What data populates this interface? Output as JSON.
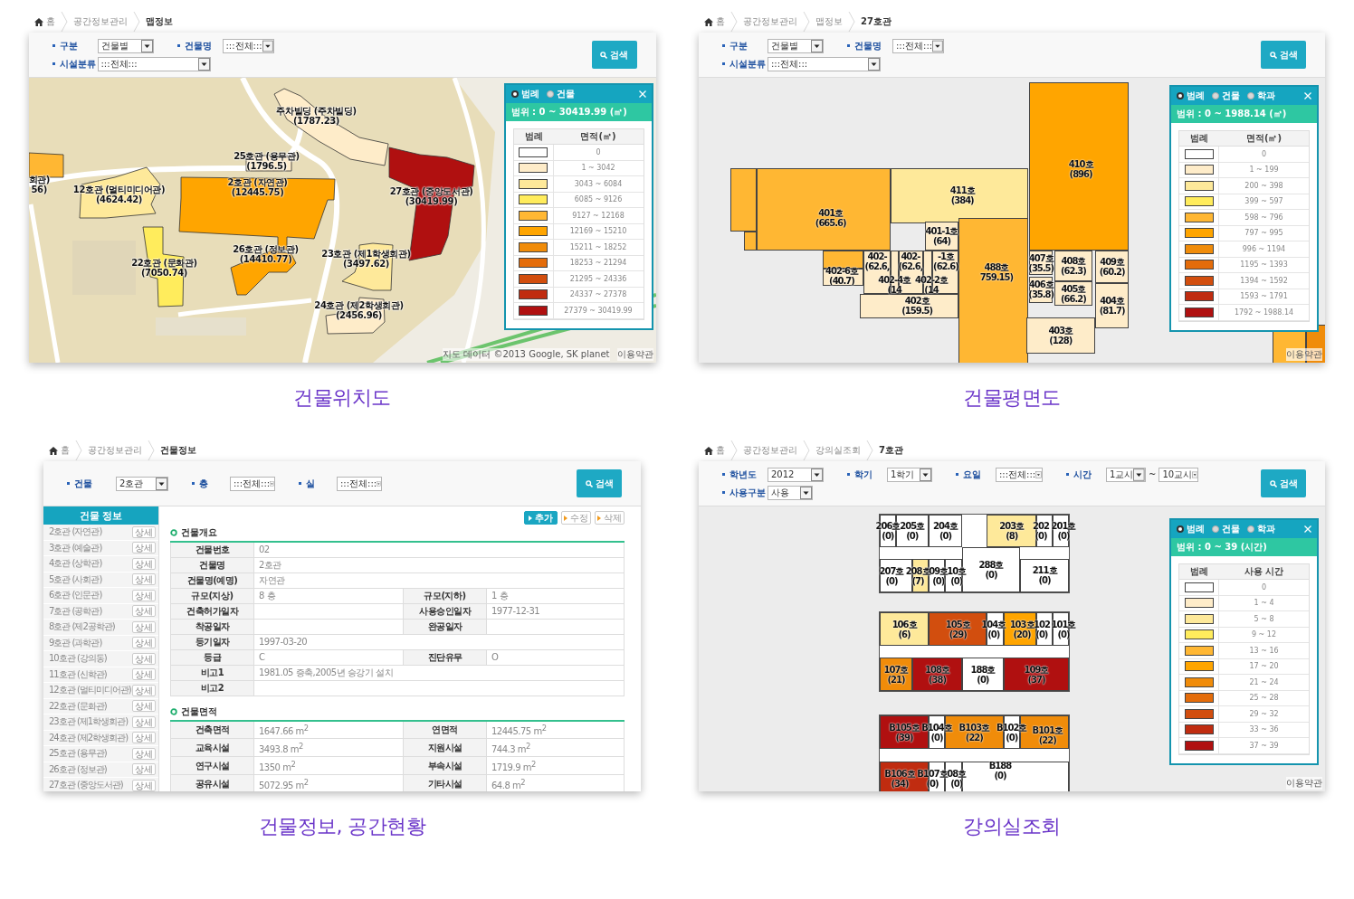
{
  "panels": [
    {
      "kind": "map",
      "breadcrumb": [
        "홈",
        "공간정보관리",
        "맵정보"
      ],
      "filter_rows": [
        [
          {
            "label": "구분",
            "values": [
              "건물별"
            ]
          },
          {
            "label": "건물명",
            "values": [
              ":::전체:::"
            ]
          }
        ],
        [
          {
            "label": "시설분류",
            "values": [
              ":::전체:::"
            ]
          }
        ]
      ],
      "search": "검색",
      "buildings": [
        {
          "name": "주차빌딩 (주차빌딩)",
          "area": "(1787.23)",
          "color": "#feecc9"
        },
        {
          "name": "회관)",
          "area": "56)",
          "color": "#ffb733"
        },
        {
          "name": "25호관 (용무관)",
          "area": "(1796.5)",
          "color": "#feecc9"
        },
        {
          "name": "2호관 (자연관)",
          "area": "(12445.75)",
          "color": "#ffa500"
        },
        {
          "name": "12호관 (멀티미디어관)",
          "area": "(4624.42)",
          "color": "#fee99a"
        },
        {
          "name": "27호관 (중앙도서관)",
          "area": "(30419.99)",
          "color": "#b01010"
        },
        {
          "name": "26호관 (정보관)",
          "area": "(14410.77)",
          "color": "#ffa500"
        },
        {
          "name": "22호관 (문화관)",
          "area": "(7050.74)",
          "color": "#ffec5c"
        },
        {
          "name": "23호관 (제1학생회관)",
          "area": "(3497.62)",
          "color": "#fee99a"
        },
        {
          "name": "24호관 (제2학생회관)",
          "area": "(2456.96)",
          "color": "#feecc9"
        }
      ],
      "legend": {
        "options": [
          {
            "label": "범례",
            "selected": true
          },
          {
            "label": "건물",
            "selected": false
          }
        ],
        "range": "범위 : 0 ~ 30419.99 (㎡)",
        "columns": [
          "범례",
          "면적(㎡)"
        ],
        "rows": [
          {
            "color": "#ffffff",
            "range": "0"
          },
          {
            "color": "#feecc9",
            "range": "1 ~ 3042"
          },
          {
            "color": "#fee99a",
            "range": "3043 ~ 6084"
          },
          {
            "color": "#ffec5c",
            "range": "6085 ~ 9126"
          },
          {
            "color": "#ffb733",
            "range": "9127 ~ 12168"
          },
          {
            "color": "#ffa500",
            "range": "12169 ~ 15210"
          },
          {
            "color": "#f08c0a",
            "range": "15211 ~ 18252"
          },
          {
            "color": "#e46c0a",
            "range": "18253 ~ 21294"
          },
          {
            "color": "#d24e0e",
            "range": "21295 ~ 24336"
          },
          {
            "color": "#c02c10",
            "range": "24337 ~ 27378"
          },
          {
            "color": "#b01010",
            "range": "27379 ~ 30419.99"
          }
        ]
      },
      "attribution": "지도 데이터 ©2013 Google, SK planet",
      "terms": "이용약관",
      "caption": "건물위치도"
    },
    {
      "kind": "floorplan",
      "breadcrumb": [
        "홈",
        "공간정보관리",
        "맵정보",
        "27호관"
      ],
      "filter_rows": [
        [
          {
            "label": "구분",
            "values": [
              "건물별"
            ]
          },
          {
            "label": "건물명",
            "values": [
              ":::전체:::"
            ]
          }
        ],
        [
          {
            "label": "시설분류",
            "values": [
              ":::전체:::"
            ]
          }
        ]
      ],
      "search": "검색",
      "rooms": [
        {
          "color": "#ffb733"
        },
        {
          "name": "401호",
          "value": "(665.6)",
          "color": "#ffb733"
        },
        {
          "color": "#ffb733"
        },
        {
          "color": "#ffb733"
        },
        {
          "name": "411호",
          "value": "(384)",
          "color": "#fee99a"
        },
        {
          "name": "410호",
          "value": "(896)",
          "color": "#ffa500"
        },
        {
          "name": "401-1호",
          "value": "(64)",
          "color": "#feecc9"
        },
        {
          "name": "402-6호",
          "value": "(40.7)",
          "color": "#feecc9"
        },
        {
          "name": "402-",
          "value": "(62.6,",
          "color": "#feecc9"
        },
        {
          "name": "402-4호",
          "value": "(14",
          "color": "#feecc9"
        },
        {
          "name": "402-",
          "value": "(62.6,",
          "color": "#feecc9"
        },
        {
          "name": "402-2호",
          "value": "(14",
          "color": "#feecc9"
        },
        {
          "name": "-1호",
          "value": "(62.6)",
          "color": "#feecc9"
        },
        {
          "name": "402호",
          "value": "(159.5)",
          "color": "#feecc9"
        },
        {
          "name": "488호",
          "value": "759.15)",
          "color": "#ffb733"
        },
        {
          "name": "407호",
          "value": "(35.5)",
          "color": "#feecc9"
        },
        {
          "name": "408호",
          "value": "(62.3)",
          "color": "#feecc9"
        },
        {
          "name": "409호",
          "value": "(60.2)",
          "color": "#feecc9"
        },
        {
          "name": "406호",
          "value": "(35.8)",
          "color": "#feecc9"
        },
        {
          "name": "405호",
          "value": "(66.2)",
          "color": "#feecc9"
        },
        {
          "name": "404호",
          "value": "(81.7)",
          "color": "#feecc9"
        },
        {
          "name": "403호",
          "value": "(128)",
          "color": "#feecc9"
        },
        {
          "color": "#ffb733"
        },
        {
          "color": "#f08c0a"
        }
      ],
      "legend": {
        "options": [
          {
            "label": "범례",
            "selected": true
          },
          {
            "label": "건물",
            "selected": false
          },
          {
            "label": "학과",
            "selected": false
          }
        ],
        "range": "범위 : 0 ~ 1988.14 (㎡)",
        "columns": [
          "범례",
          "면적(㎡)"
        ],
        "rows": [
          {
            "color": "#ffffff",
            "range": "0"
          },
          {
            "color": "#feecc9",
            "range": "1 ~ 199"
          },
          {
            "color": "#fee99a",
            "range": "200 ~ 398"
          },
          {
            "color": "#ffec5c",
            "range": "399 ~ 597"
          },
          {
            "color": "#ffb733",
            "range": "598 ~ 796"
          },
          {
            "color": "#ffa500",
            "range": "797 ~ 995"
          },
          {
            "color": "#f08c0a",
            "range": "996 ~ 1194"
          },
          {
            "color": "#e46c0a",
            "range": "1195 ~ 1393"
          },
          {
            "color": "#d24e0e",
            "range": "1394 ~ 1592"
          },
          {
            "color": "#c02c10",
            "range": "1593 ~ 1791"
          },
          {
            "color": "#b01010",
            "range": "1792 ~ 1988.14"
          }
        ]
      },
      "terms": "이용약관",
      "caption": "건물평면도"
    },
    {
      "kind": "info",
      "breadcrumb": [
        "홈",
        "공간정보관리",
        "건물정보"
      ],
      "filter_rows": [
        [
          {
            "label": "건물",
            "values": [
              "2호관"
            ]
          },
          {
            "label": "층",
            "values": [
              ":::전체:::"
            ]
          },
          {
            "label": "실",
            "values": [
              ":::전체:::"
            ]
          }
        ]
      ],
      "search": "검색",
      "list_title": "건물 정보",
      "list": [
        {
          "name": "2호관 (자연관)",
          "action": "상세"
        },
        {
          "name": "3호관 (예술관)",
          "action": "상세"
        },
        {
          "name": "4호관 (상학관)",
          "action": "상세"
        },
        {
          "name": "5호관 (사회관)",
          "action": "상세"
        },
        {
          "name": "6호관 (인문관)",
          "action": "상세"
        },
        {
          "name": "7호관 (공학관)",
          "action": "상세"
        },
        {
          "name": "8호관 (제2공학관)",
          "action": "상세"
        },
        {
          "name": "9호관 (과학관)",
          "action": "상세"
        },
        {
          "name": "10호관 (강의동)",
          "action": "상세"
        },
        {
          "name": "11호관 (신학관)",
          "action": "상세"
        },
        {
          "name": "12호관 (멀티미디어관)",
          "action": "상세"
        },
        {
          "name": "22호관 (문화관)",
          "action": "상세"
        },
        {
          "name": "23호관 (제1학생회관)",
          "action": "상세"
        },
        {
          "name": "24호관 (제2학생회관)",
          "action": "상세"
        },
        {
          "name": "25호관 (용무관)",
          "action": "상세"
        },
        {
          "name": "26호관 (정보관)",
          "action": "상세"
        },
        {
          "name": "27호관 (중앙도서관)",
          "action": "상세"
        }
      ],
      "actions": [
        {
          "label": "추가",
          "kind": "primary"
        },
        {
          "label": "수정",
          "kind": "plain"
        },
        {
          "label": "삭제",
          "kind": "plain"
        }
      ],
      "sections": [
        {
          "title": "건물개요",
          "rows": [
            [
              {
                "label": "건물번호",
                "value": "02"
              }
            ],
            [
              {
                "label": "건물명",
                "value": "2호관"
              }
            ],
            [
              {
                "label": "건물명(예명)",
                "value": "자연관"
              }
            ],
            [
              {
                "label": "규모(지상)",
                "value": "8 층"
              },
              {
                "label": "규모(지하)",
                "value": "1 층"
              }
            ],
            [
              {
                "label": "건축허가일자"
              },
              {
                "label": "사용승인일자",
                "value": "1977-12-31"
              }
            ],
            [
              {
                "label": "착공일자"
              },
              {
                "label": "완공일자"
              }
            ],
            [
              {
                "label": "등기일자",
                "value": "1997-03-20"
              }
            ],
            [
              {
                "label": "등급",
                "value": "C"
              },
              {
                "label": "진단유무",
                "value": "O"
              }
            ],
            [
              {
                "label": "비고1",
                "value": "1981.05 증축,2005년 승강기 설치"
              }
            ],
            [
              {
                "label": "비고2"
              }
            ]
          ]
        },
        {
          "title": "건물면적",
          "rows": [
            [
              {
                "label": "건축면적",
                "value": "1647.66 m$^{2}$"
              },
              {
                "label": "연면적",
                "value": "12445.75 m$^{2}$"
              }
            ],
            [
              {
                "label": "교육시설",
                "value": "3493.8 m$^{2}$"
              },
              {
                "label": "지원시설",
                "value": "744.3 m$^{2}$"
              }
            ],
            [
              {
                "label": "연구시설",
                "value": "1350 m$^{2}$"
              },
              {
                "label": "부속시설",
                "value": "1719.9 m$^{2}$"
              }
            ],
            [
              {
                "label": "공유시설",
                "value": "5072.95 m$^{2}$"
              },
              {
                "label": "기타시설",
                "value": "64.8 m$^{2}$"
              }
            ]
          ]
        }
      ],
      "caption": "건물정보, 공간현황"
    },
    {
      "kind": "rooms",
      "breadcrumb": [
        "홈",
        "공간정보관리",
        "강의실조회",
        "7호관"
      ],
      "filter_rows": [
        [
          {
            "label": "학년도",
            "values": [
              "2012"
            ]
          },
          {
            "label": "학기",
            "values": [
              "1학기"
            ]
          },
          {
            "label": "요일",
            "values": [
              ":::전체:::"
            ]
          },
          {
            "label": "시간",
            "values": [
              "1교시",
              "10교시"
            ],
            "joiner": "~"
          }
        ],
        [
          {
            "label": "사용구분",
            "values": [
              "사용"
            ]
          }
        ]
      ],
      "search": "검색",
      "rooms": [
        {
          "name": "206호",
          "value": "(0)",
          "color": "#ffffff"
        },
        {
          "name": "205호",
          "value": "(0)",
          "color": "#ffffff"
        },
        {
          "name": "204호",
          "value": "(0)",
          "color": "#ffffff"
        },
        {
          "name": "203호",
          "value": "(8)",
          "color": "#fee99a"
        },
        {
          "name": "202",
          "value": "(0)",
          "color": "#ffffff"
        },
        {
          "name": "201호",
          "value": "(0)",
          "color": "#ffffff"
        },
        {
          "name": "207호",
          "value": "(0)",
          "color": "#ffffff"
        },
        {
          "name": "208호",
          "value": "(7)",
          "color": "#fee99a"
        },
        {
          "name": "09호",
          "value": "(0)",
          "color": "#ffffff"
        },
        {
          "name": "10호",
          "value": "(0)",
          "color": "#ffffff"
        },
        {
          "name": "288호",
          "value": "(0)",
          "color": "#ffffff"
        },
        {
          "name": "211호",
          "value": "(0)",
          "color": "#ffffff"
        },
        {
          "name": "106호",
          "value": "(6)",
          "color": "#fee99a"
        },
        {
          "name": "105호",
          "value": "(29)",
          "color": "#d24e0e"
        },
        {
          "name": "104호",
          "value": "(0)",
          "color": "#ffffff"
        },
        {
          "name": "103호",
          "value": "(20)",
          "color": "#ffa500"
        },
        {
          "name": "102",
          "value": "(0)",
          "color": "#ffffff"
        },
        {
          "name": "101호",
          "value": "(0)",
          "color": "#ffffff"
        },
        {
          "name": "107호",
          "value": "(21)",
          "color": "#f08c0a"
        },
        {
          "name": "108호",
          "value": "(38)",
          "color": "#b01010"
        },
        {
          "name": "188호",
          "value": "(0)",
          "color": "#ffffff"
        },
        {
          "name": "109호",
          "value": "(37)",
          "color": "#b01010"
        },
        {
          "name": "B105호",
          "value": "(39)",
          "color": "#b01010"
        },
        {
          "name": "B104호",
          "value": "(0)",
          "color": "#ffffff"
        },
        {
          "name": "B103호",
          "value": "(22)",
          "color": "#f08c0a"
        },
        {
          "name": "B102호",
          "value": "(0)",
          "color": "#ffffff"
        },
        {
          "name": "B101호",
          "value": "(22)",
          "color": "#f08c0a"
        },
        {
          "name": "B106호",
          "value": "(34)",
          "color": "#c02c10"
        },
        {
          "name": "B107호",
          "value": "(0)",
          "color": "#ffffff"
        },
        {
          "name": "08호",
          "value": "(0)",
          "color": "#ffffff"
        },
        {
          "name": "B188",
          "value": "(0)",
          "color": "#ffffff"
        }
      ],
      "legend": {
        "options": [
          {
            "label": "범례",
            "selected": true
          },
          {
            "label": "건물",
            "selected": false
          },
          {
            "label": "학과",
            "selected": false
          }
        ],
        "range": "범위 : 0 ~ 39 (시간)",
        "columns": [
          "범례",
          "사용 시간"
        ],
        "rows": [
          {
            "color": "#ffffff",
            "range": "0"
          },
          {
            "color": "#feecc9",
            "range": "1 ~ 4"
          },
          {
            "color": "#fee99a",
            "range": "5 ~ 8"
          },
          {
            "color": "#ffec5c",
            "range": "9 ~ 12"
          },
          {
            "color": "#ffb733",
            "range": "13 ~ 16"
          },
          {
            "color": "#ffa500",
            "range": "17 ~ 20"
          },
          {
            "color": "#f08c0a",
            "range": "21 ~ 24"
          },
          {
            "color": "#e46c0a",
            "range": "25 ~ 28"
          },
          {
            "color": "#d24e0e",
            "range": "29 ~ 32"
          },
          {
            "color": "#c02c10",
            "range": "33 ~ 36"
          },
          {
            "color": "#b01010",
            "range": "37 ~ 39"
          }
        ]
      },
      "terms": "이용약관",
      "caption": "강의실조회"
    }
  ]
}
